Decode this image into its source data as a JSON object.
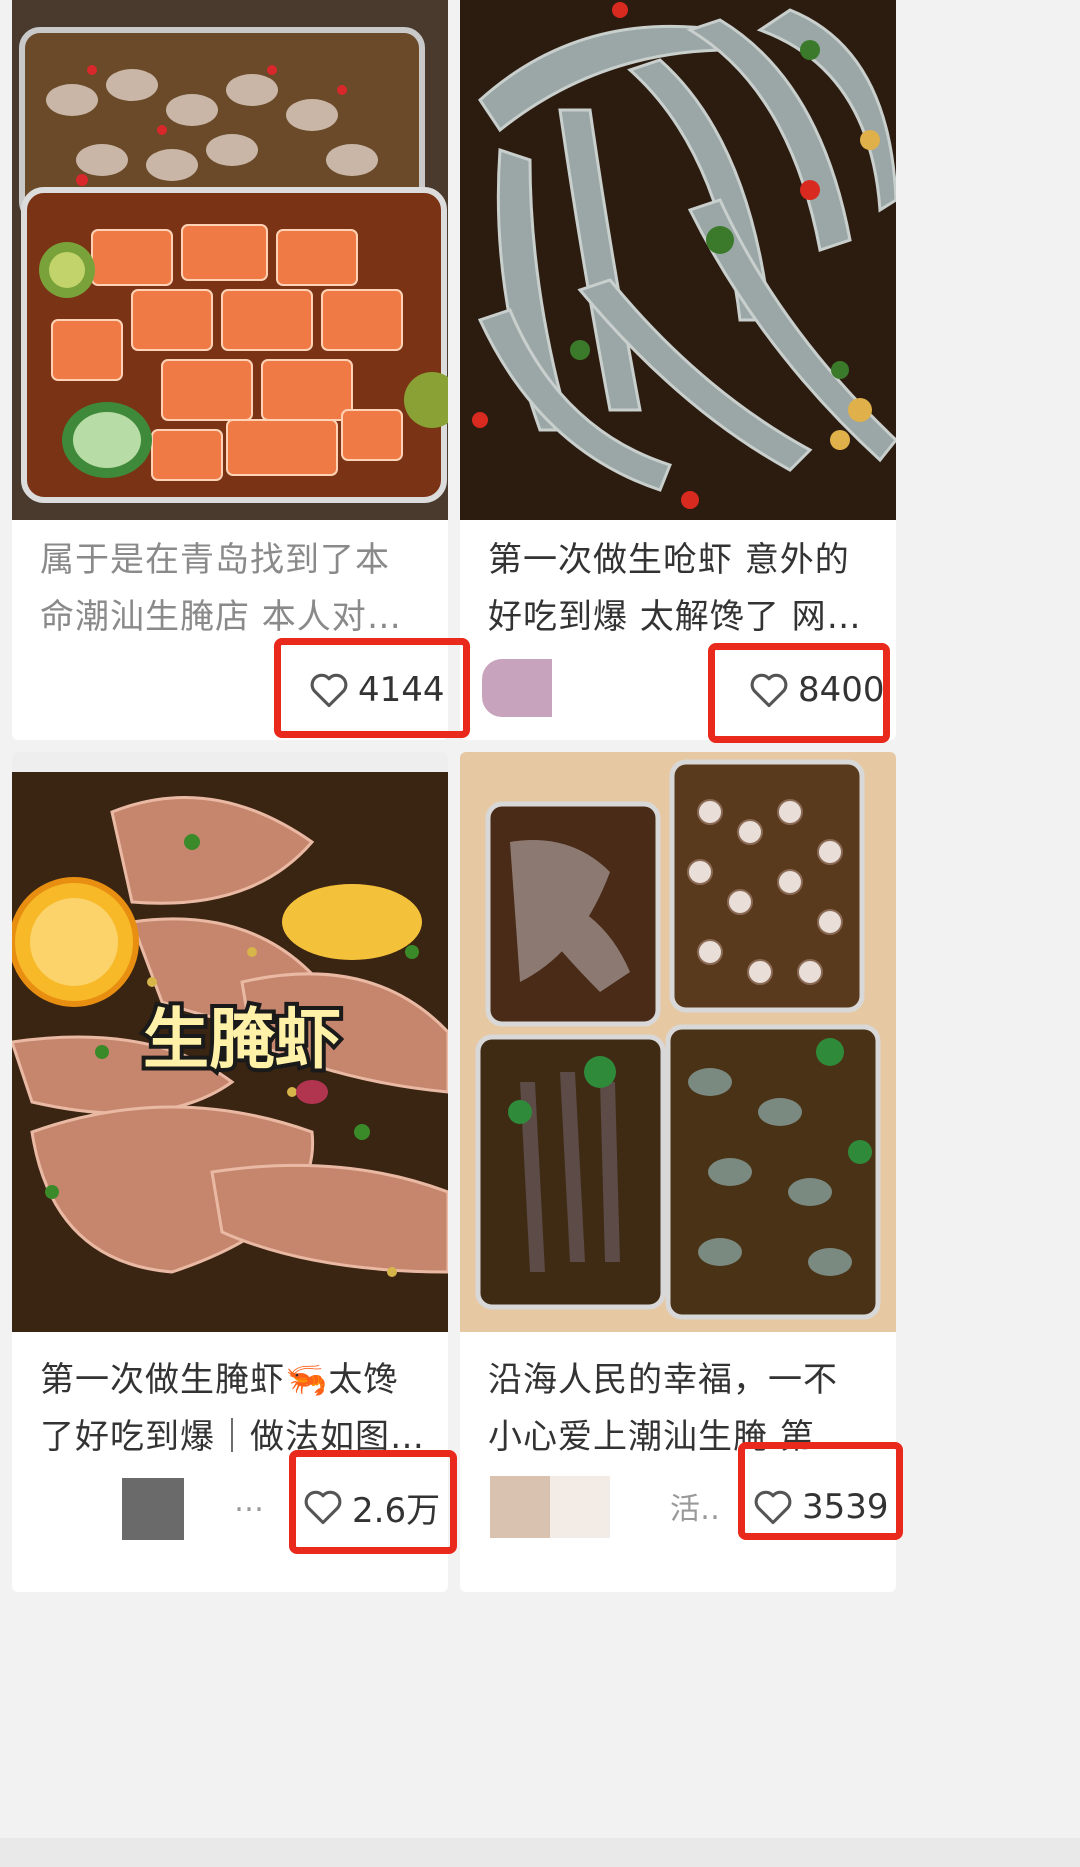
{
  "posts": [
    {
      "title": "属于是在青岛找到了本命潮汕生腌店 本人对生食…",
      "author": "",
      "likes": "4144",
      "image": "salmon-shrimp-marinated-boxes"
    },
    {
      "title": "第一次做生呛虾 意外的好吃到爆 太解馋了 网红生…",
      "author": "",
      "likes": "8400",
      "image": "raw-marinated-shrimp"
    },
    {
      "title": "第一次做生腌虾🦐太馋了好吃到爆｜做法如图 总…",
      "author": "…",
      "likes": "2.6万",
      "image": "marinated-shrimp-lemon",
      "overlay_text": "生腌虾"
    },
    {
      "title": "沿海人民的幸福，一不小心爱上潮汕生腌 第一次…",
      "author": "活…",
      "likes": "3539",
      "image": "four-marinated-seafood-boxes"
    }
  ],
  "icons": {
    "like": "heart-outline-icon"
  },
  "colors": {
    "highlight_box": "#e8291c",
    "card": "#ffffff",
    "background": "#f2f2f2"
  }
}
